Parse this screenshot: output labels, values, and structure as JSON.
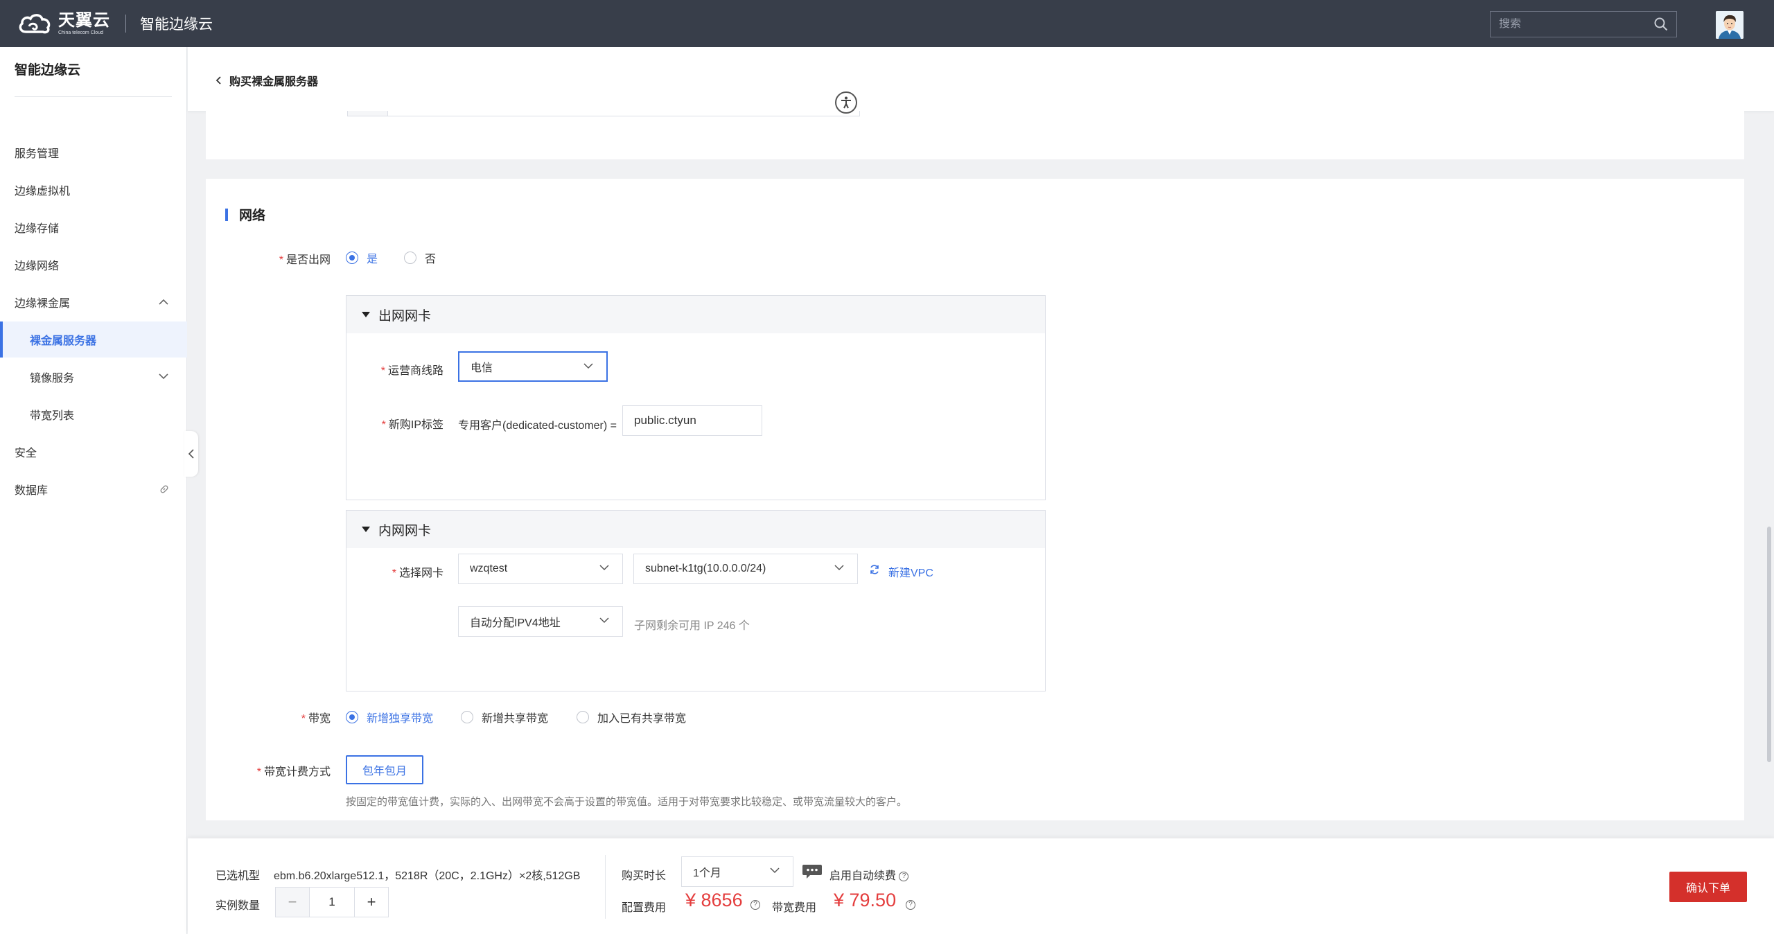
{
  "topbar": {
    "brand_cn": "天翼云",
    "brand_en": "China telecom Cloud",
    "product": "智能边缘云",
    "search_placeholder": "搜索"
  },
  "sidebar": {
    "title": "智能边缘云",
    "items": [
      {
        "label": "服务管理"
      },
      {
        "label": "边缘虚拟机"
      },
      {
        "label": "边缘存储"
      },
      {
        "label": "边缘网络"
      },
      {
        "label": "边缘裸金属"
      },
      {
        "label": "裸金属服务器"
      },
      {
        "label": "镜像服务"
      },
      {
        "label": "带宽列表"
      },
      {
        "label": "安全"
      },
      {
        "label": "数据库"
      }
    ]
  },
  "header": {
    "back_title": "购买裸金属服务器"
  },
  "network": {
    "section_title": "网络",
    "internet_label": "是否出网",
    "internet_yes": "是",
    "internet_no": "否",
    "egress_panel": {
      "title": "出网网卡",
      "carrier_label": "运营商线路",
      "carrier_value": "电信",
      "ip_tag_label": "新购IP标签",
      "ip_tag_key": "专用客户(dedicated-customer) =",
      "ip_tag_value": "public.ctyun"
    },
    "internal_panel": {
      "title": "内网网卡",
      "nic_label": "选择网卡",
      "vpc_value": "wzqtest",
      "subnet_value": "subnet-k1tg(10.0.0.0/24)",
      "new_vpc_link": "新建VPC",
      "ipv4_value": "自动分配IPV4地址",
      "ip_remaining_hint": "子网剩余可用 IP 246 个"
    },
    "bandwidth_label": "带宽",
    "bandwidth_options": [
      "新增独享带宽",
      "新增共享带宽",
      "加入已有共享带宽"
    ],
    "billing_label": "带宽计费方式",
    "billing_button": "包年包月",
    "billing_hint": "按固定的带宽值计费，实际的入、出网带宽不会高于设置的带宽值。适用于对带宽要求比较稳定、或带宽流量较大的客户。"
  },
  "footer": {
    "model_label": "已选机型",
    "model_value": "ebm.b6.20xlarge512.1，5218R（20C，2.1GHz）×2核,512GB",
    "quantity_label": "实例数量",
    "quantity_value": "1",
    "minus": "−",
    "plus": "+",
    "duration_label": "购买时长",
    "duration_value": "1个月",
    "auto_renew_label": "启用自动续费",
    "config_fee_label": "配置费用",
    "config_fee_value": "¥ 8656",
    "bandwidth_fee_label": "带宽费用",
    "bandwidth_fee_value": "¥ 79.50",
    "confirm_button": "确认下单"
  },
  "colors": {
    "topbar_bg": "#383e4a",
    "accent": "#3b72e4",
    "price_red": "#e43d3d",
    "confirm_red": "#d4302b"
  }
}
